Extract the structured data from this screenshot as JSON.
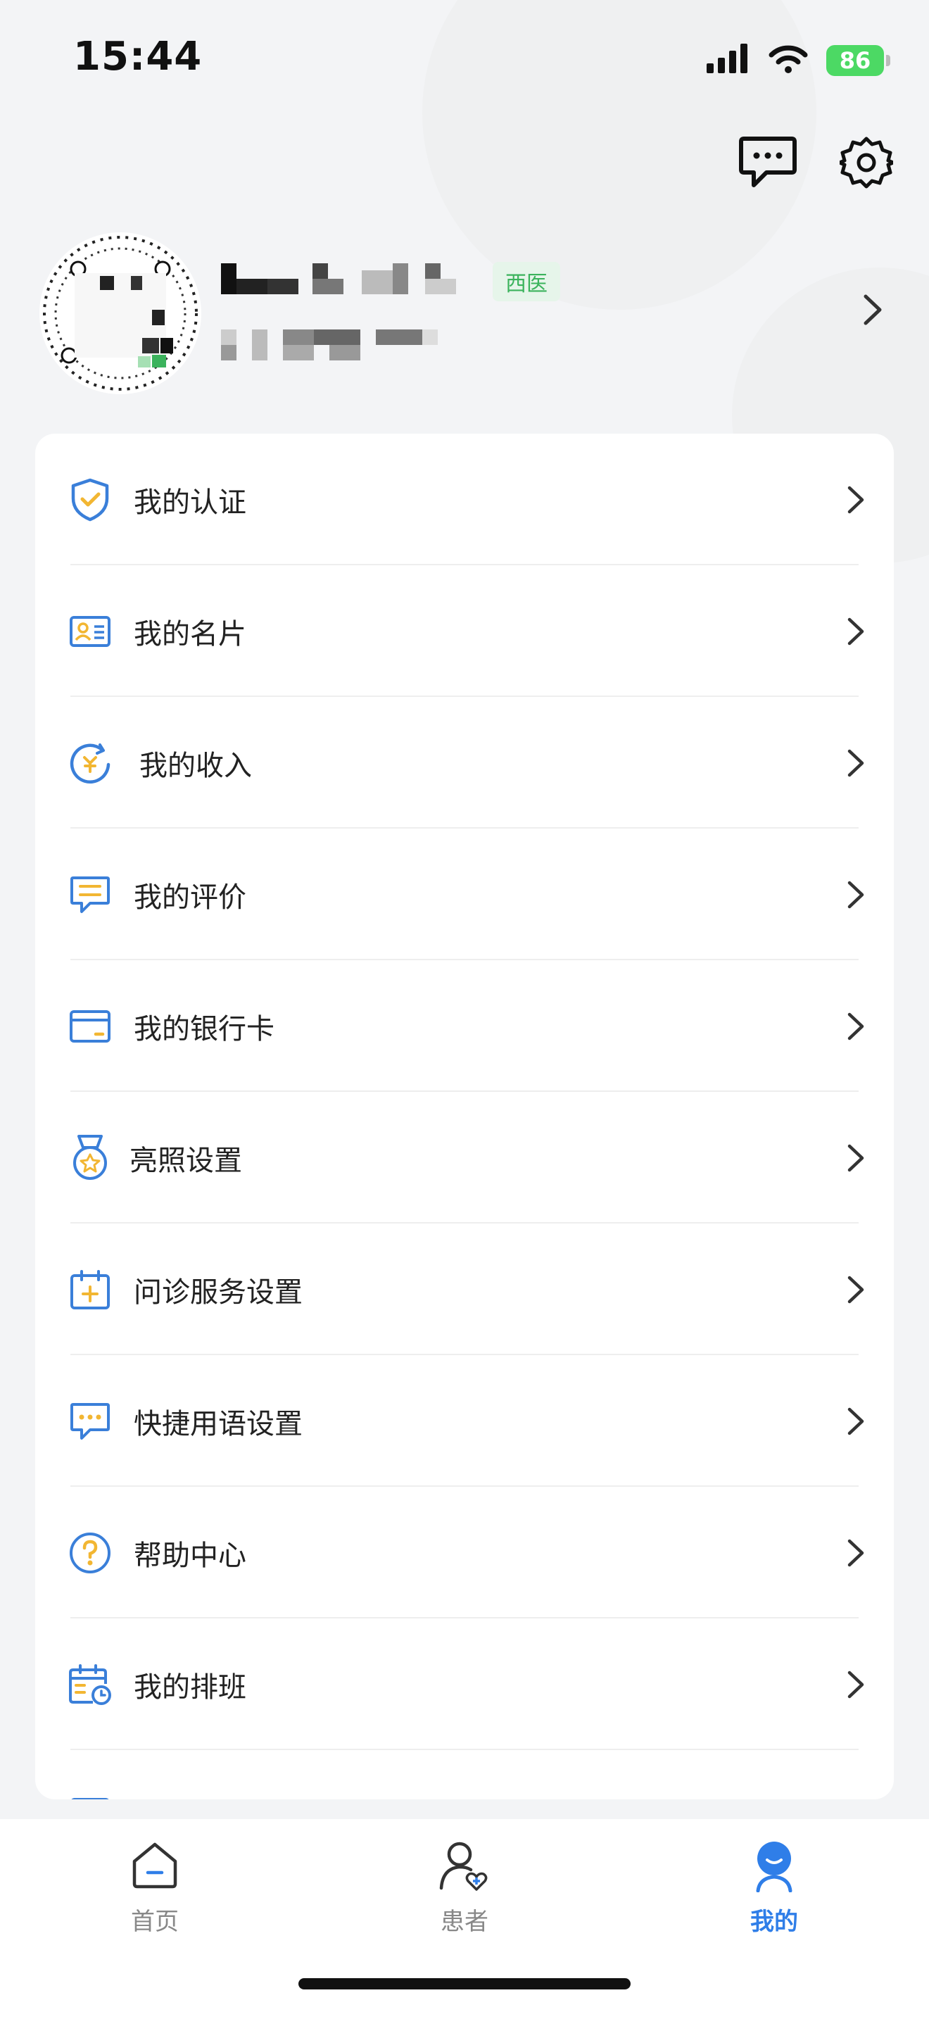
{
  "status_bar": {
    "time": "15:44",
    "battery": "86"
  },
  "header": {
    "message_icon": "chat-bubble-icon",
    "settings_icon": "gear-icon"
  },
  "profile": {
    "tag": "西医",
    "avatar_icon": "qr-avatar-icon"
  },
  "menu": {
    "items": [
      {
        "label": "我的认证",
        "icon": "shield-check-icon"
      },
      {
        "label": "我的名片",
        "icon": "id-card-icon"
      },
      {
        "label": "我的收入",
        "icon": "income-icon"
      },
      {
        "label": "我的评价",
        "icon": "comment-icon"
      },
      {
        "label": "我的银行卡",
        "icon": "bank-card-icon"
      },
      {
        "label": "亮照设置",
        "icon": "medal-icon"
      },
      {
        "label": "问诊服务设置",
        "icon": "calendar-plus-icon"
      },
      {
        "label": "快捷用语设置",
        "icon": "quick-reply-icon"
      },
      {
        "label": "帮助中心",
        "icon": "help-icon"
      },
      {
        "label": "我的排班",
        "icon": "schedule-icon"
      }
    ]
  },
  "tabbar": {
    "tabs": [
      {
        "label": "首页",
        "icon": "home-icon",
        "active": false
      },
      {
        "label": "患者",
        "icon": "patient-icon",
        "active": false
      },
      {
        "label": "我的",
        "icon": "profile-icon",
        "active": true
      }
    ]
  },
  "colors": {
    "accent": "#2f7ee8",
    "icon_yellow": "#f2b632",
    "tag_green": "#3bb35c",
    "battery_green": "#4cd964"
  }
}
